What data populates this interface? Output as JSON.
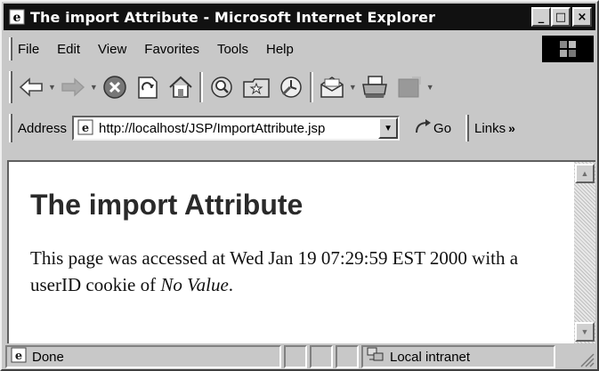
{
  "window": {
    "title": "The import Attribute - Microsoft Internet Explorer",
    "minimize": "_",
    "maximize": "□",
    "close": "×"
  },
  "menu": {
    "items": [
      {
        "label": "File"
      },
      {
        "label": "Edit"
      },
      {
        "label": "View"
      },
      {
        "label": "Favorites"
      },
      {
        "label": "Tools"
      },
      {
        "label": "Help"
      }
    ]
  },
  "toolbar": {
    "buttons": [
      "back-icon",
      "forward-icon",
      "stop-icon",
      "refresh-icon",
      "home-icon",
      "search-icon",
      "favorites-icon",
      "history-icon",
      "mail-icon",
      "print-icon",
      "edit-icon"
    ]
  },
  "address": {
    "label": "Address",
    "url": "http://localhost/JSP/ImportAttribute.jsp",
    "go_label": "Go",
    "links_label": "Links",
    "links_chevron": "»"
  },
  "page": {
    "heading": "The import Attribute",
    "text_before": "This page was accessed at Wed Jan 19 07:29:59 EST 2000 with a userID cookie of ",
    "cookie_value": "No Value",
    "text_after": "."
  },
  "status": {
    "text": "Done",
    "zone": "Local intranet"
  }
}
